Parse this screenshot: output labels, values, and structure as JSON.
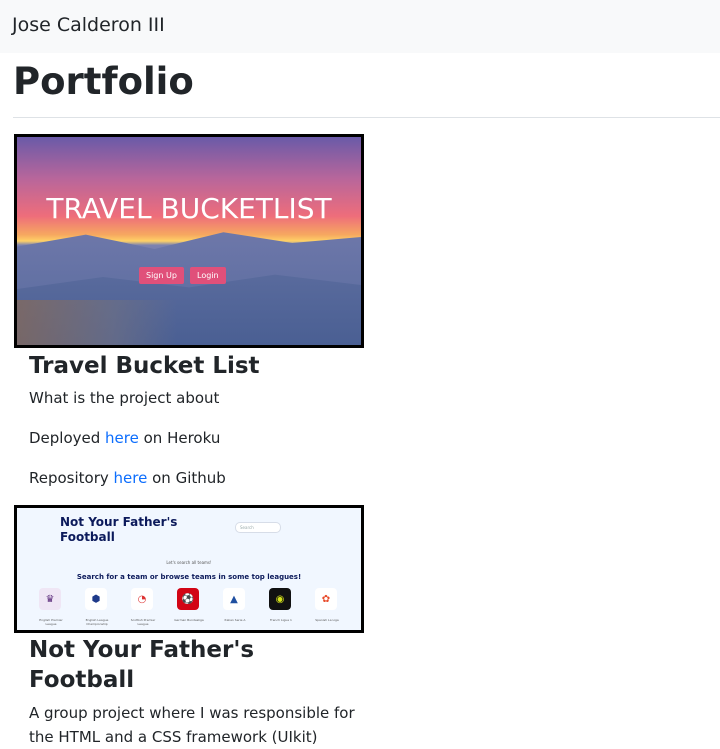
{
  "navbar": {
    "brand": "Jose Calderon III"
  },
  "page": {
    "title": "Portfolio"
  },
  "projects": [
    {
      "title": "Travel Bucket List",
      "description": "What is the project about",
      "deployed_prefix": "Deployed ",
      "deployed_link": "here",
      "deployed_suffix": " on Heroku",
      "repo_prefix": "Repository ",
      "repo_link": "here",
      "repo_suffix": " on Github",
      "image": {
        "heading": "TRAVEL BUCKETLIST",
        "signup": "Sign Up",
        "login": "Login"
      }
    },
    {
      "title": "Not Your Father's Football",
      "description": "A group project where I was responsible for the HTML and a CSS framework (UIkit)",
      "image": {
        "title_line1": "Not Your Father's",
        "title_line2": "Football",
        "search_placeholder": "Search",
        "small_text": "Let's search all teams!",
        "headline": "Search for a team or browse teams in some top leagues!",
        "leagues": [
          "English Premier League",
          "English League Championship",
          "Scottish Premier League",
          "German Bundesliga",
          "Italian Serie A",
          "French Ligue 1",
          "Spanish La Liga"
        ]
      }
    }
  ],
  "colors": {
    "link": "#0d6efd",
    "navbar_bg": "#f8f9fa",
    "accent_pink": "#e0507a"
  }
}
